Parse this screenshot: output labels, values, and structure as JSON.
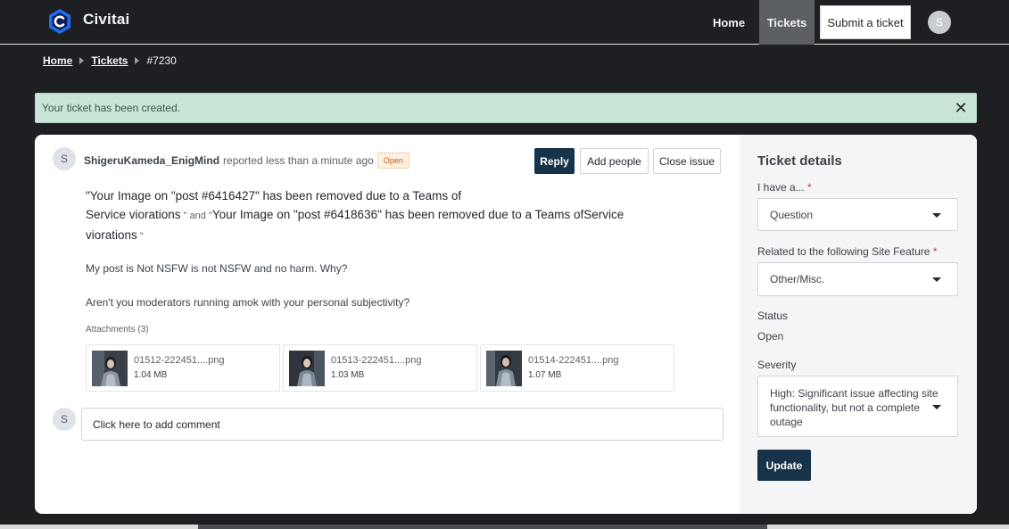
{
  "header": {
    "brand": "Civitai",
    "nav_home": "Home",
    "nav_tickets": "Tickets",
    "submit_ticket": "Submit a ticket",
    "avatar_initial": "S"
  },
  "breadcrumb": {
    "items": [
      "Home",
      "Tickets"
    ],
    "current": "#7230"
  },
  "alert": {
    "message": "Your ticket has been created.",
    "close_symbol": "✕"
  },
  "ticket": {
    "avatar_initial": "S",
    "reporter": "ShigeruKameda_EnigMind",
    "reported_time": "reported less than a minute ago",
    "status": "Open",
    "actions": {
      "reply": "Reply",
      "add_people": "Add people",
      "close_issue": "Close issue"
    },
    "message": {
      "line1": "\"Your Image on \"post #6416427\" has been removed due to a Teams of",
      "line2a": "Service viorations",
      "line2b_small": " \" and \"",
      "line2c": "Your Image on \"post #6418636\" has been removed due to a Teams ofService",
      "line3": "viorations",
      "line3_small": " \""
    },
    "paragraph1": "My post is Not NSFW is not NSFW and no harm. Why?",
    "paragraph2": "Aren't you moderators running amok with your personal subjectivity?",
    "attachments_label": "Attachments (3)",
    "attachments": [
      {
        "name": "01512-222451....png",
        "size": "1.04 MB"
      },
      {
        "name": "01513-222451....png",
        "size": "1.03 MB"
      },
      {
        "name": "01514-222451....png",
        "size": "1.07 MB"
      }
    ],
    "comment_avatar_initial": "S",
    "comment_placeholder": "Click here to add comment"
  },
  "details": {
    "title": "Ticket details",
    "i_have_label": "I have a...",
    "i_have_value": "Question",
    "feature_label": "Related to the following Site Feature",
    "feature_value": "Other/Misc.",
    "required_mark": "*",
    "status_label": "Status",
    "status_value": "Open",
    "severity_label": "Severity",
    "severity_value": "High: Significant issue affecting site functionality, but not a complete outage",
    "update_button": "Update"
  },
  "colors": {
    "dark_bg": "#1d1f22",
    "primary": "#173349",
    "alert_bg": "#c9e5d8",
    "badge_bg": "#fff0e1",
    "badge_text": "#c0601e"
  }
}
